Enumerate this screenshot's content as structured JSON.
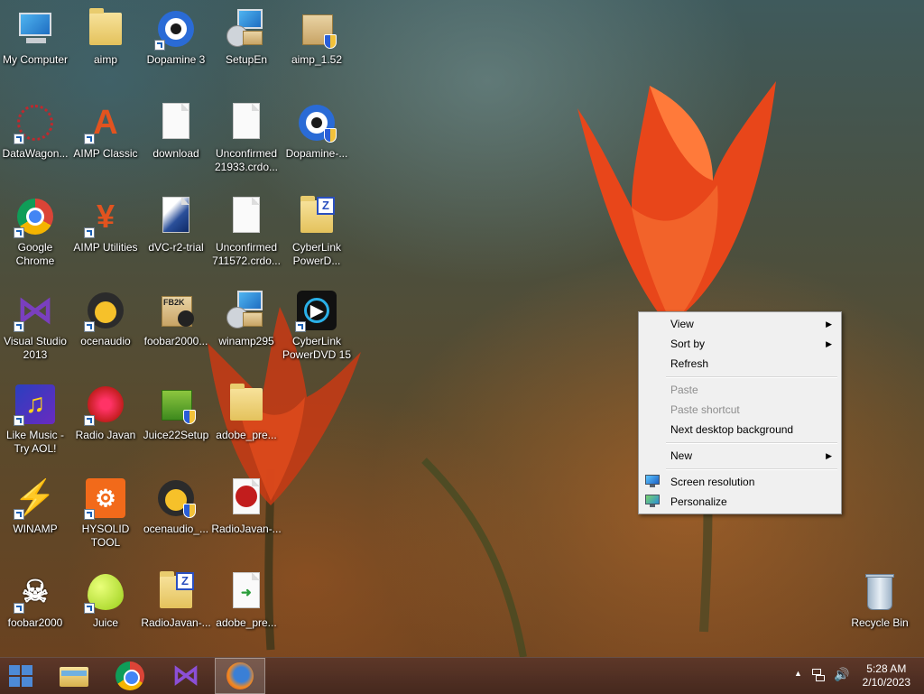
{
  "desktop": {
    "icons": [
      {
        "label": "My Computer"
      },
      {
        "label": "aimp"
      },
      {
        "label": "Dopamine 3"
      },
      {
        "label": "SetupEn"
      },
      {
        "label": "aimp_1.52"
      },
      {
        "label": "DataWagon..."
      },
      {
        "label": "AIMP Classic"
      },
      {
        "label": "download"
      },
      {
        "label": "Unconfirmed 21933.crdo..."
      },
      {
        "label": "Dopamine-..."
      },
      {
        "label": "Google Chrome"
      },
      {
        "label": "AIMP Utilities"
      },
      {
        "label": "dVC-r2-trial"
      },
      {
        "label": "Unconfirmed 711572.crdo..."
      },
      {
        "label": "CyberLink PowerD..."
      },
      {
        "label": "Visual Studio 2013"
      },
      {
        "label": "ocenaudio"
      },
      {
        "label": "foobar2000..."
      },
      {
        "label": "winamp295"
      },
      {
        "label": "CyberLink PowerDVD 15"
      },
      {
        "label": "Like Music - Try AOL!"
      },
      {
        "label": "Radio Javan"
      },
      {
        "label": "Juice22Setup"
      },
      {
        "label": "adobe_pre..."
      },
      {
        "label": "WINAMP"
      },
      {
        "label": "HYSOLID TOOL"
      },
      {
        "label": "ocenaudio_..."
      },
      {
        "label": "RadioJavan-..."
      },
      {
        "label": "foobar2000"
      },
      {
        "label": "Juice"
      },
      {
        "label": "RadioJavan-..."
      },
      {
        "label": "adobe_pre..."
      },
      {
        "label": "Recycle Bin"
      }
    ]
  },
  "context_menu": {
    "view": "View",
    "sort_by": "Sort by",
    "refresh": "Refresh",
    "paste": "Paste",
    "paste_shortcut": "Paste shortcut",
    "next_background": "Next desktop background",
    "new": "New",
    "screen_resolution": "Screen resolution",
    "personalize": "Personalize",
    "submenu_arrow": "▶"
  },
  "taskbar": {
    "pinned": [
      "File Explorer",
      "Google Chrome",
      "Visual Studio",
      "Firefox"
    ],
    "tray_up_arrow": "▲",
    "time": "5:28 AM",
    "date": "2/10/2023"
  },
  "colors": {
    "menu_bg": "#f0f0f0",
    "taskbar": "#5f3728",
    "start_accent": "#4d8ad6"
  }
}
